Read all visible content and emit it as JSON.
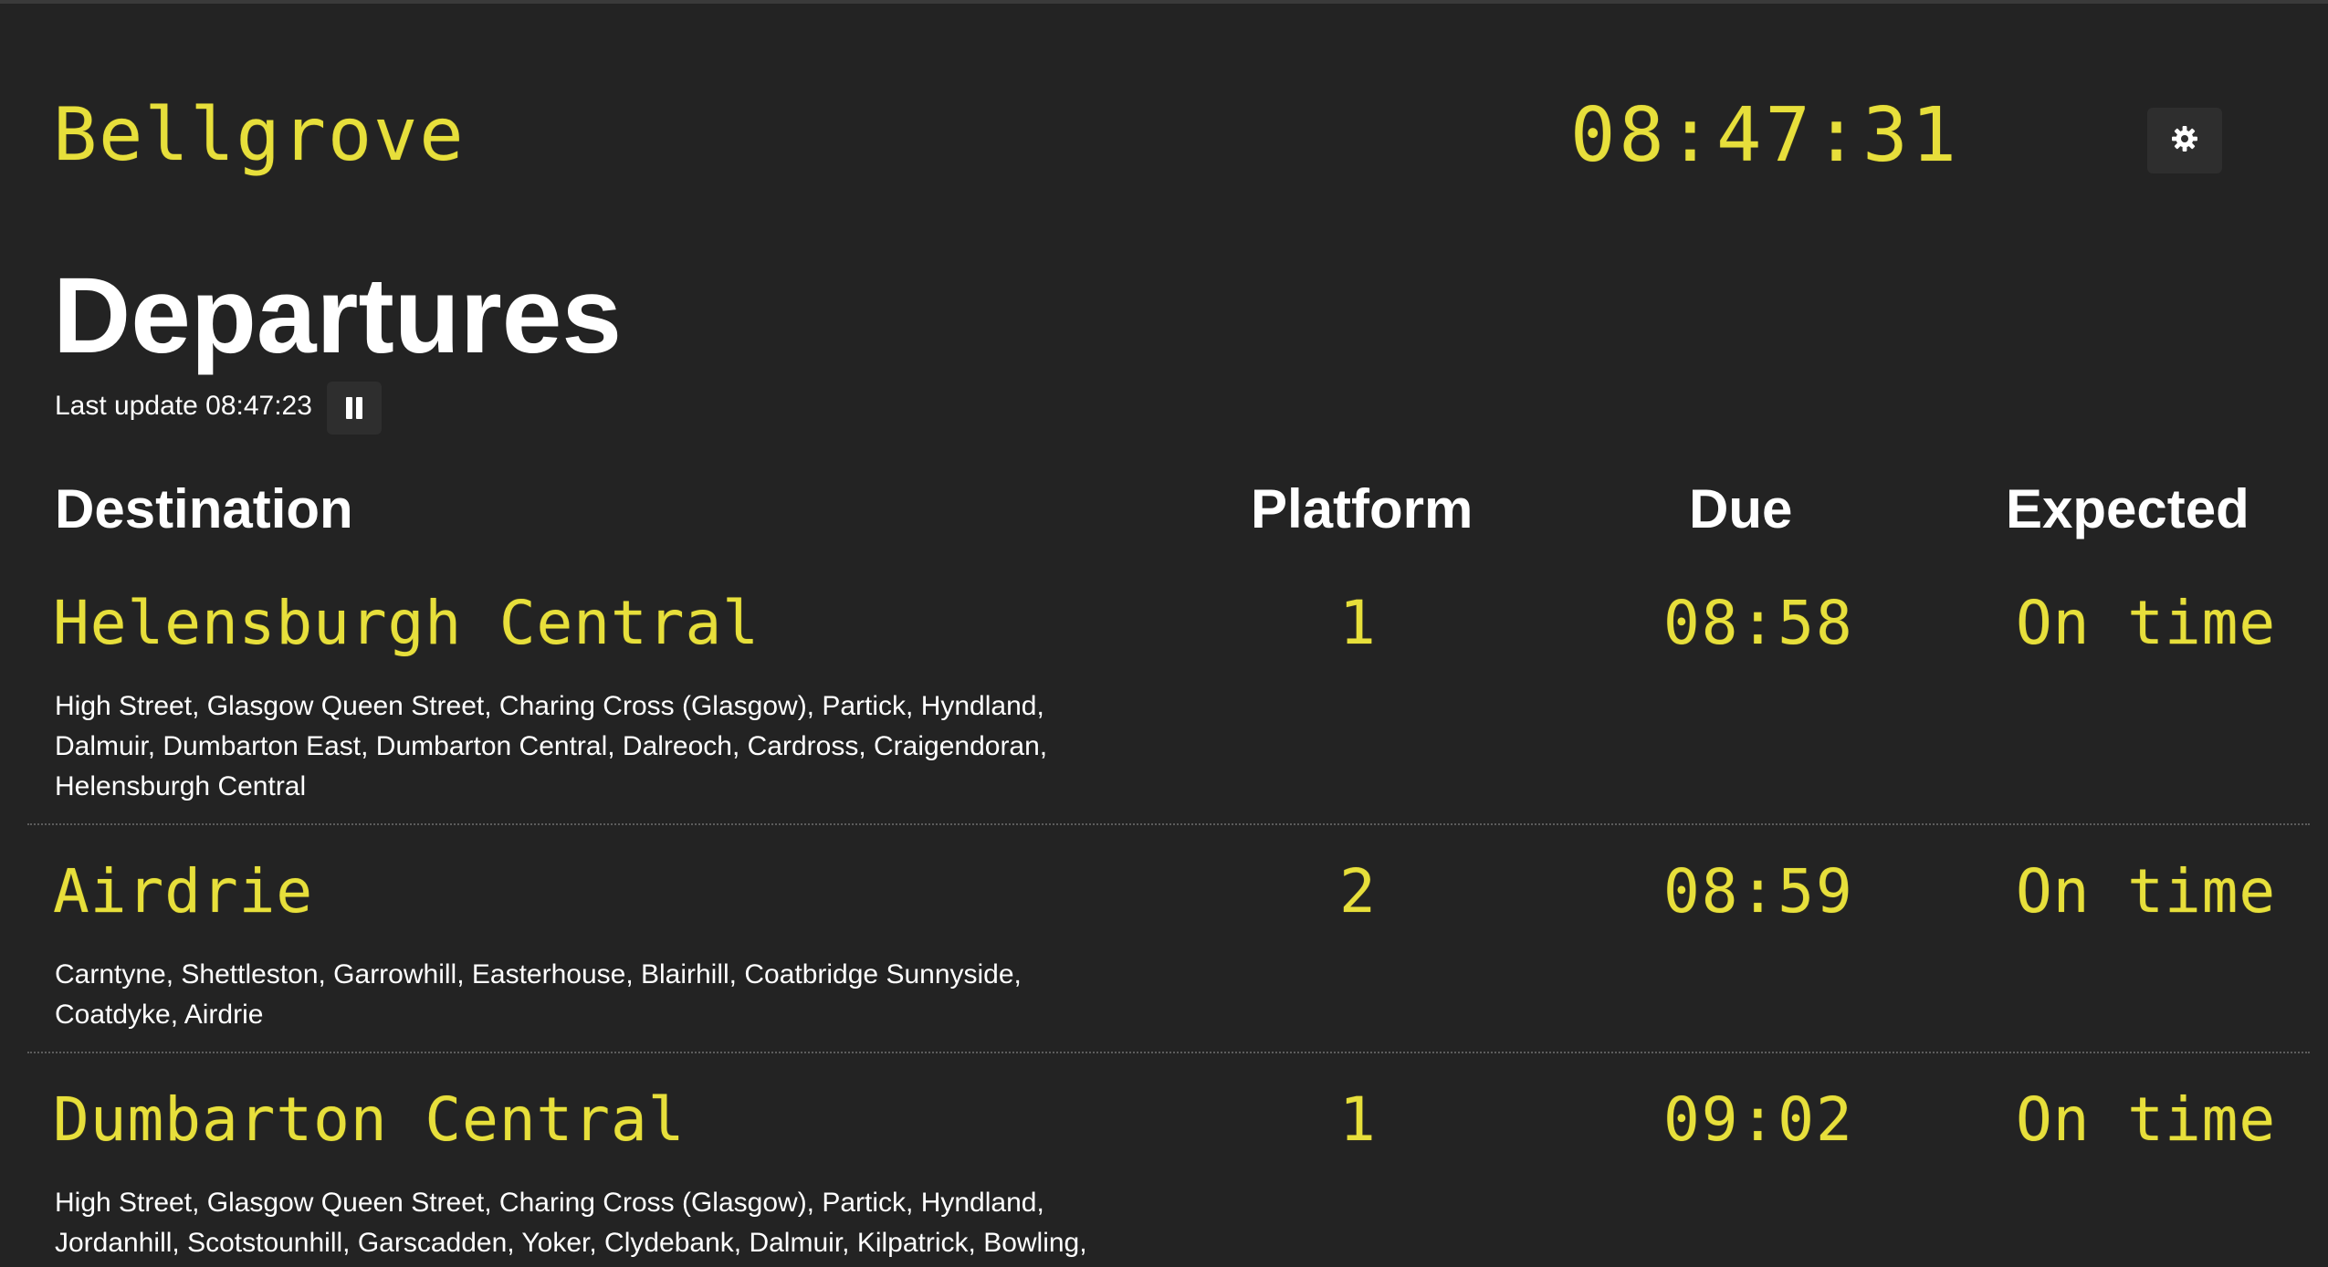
{
  "header": {
    "station": "Bellgrove",
    "clock": "08:47:31",
    "settings_icon": "gear-icon"
  },
  "title": "Departures",
  "status": {
    "last_update": "Last update 08:47:23",
    "pause_icon": "pause-icon"
  },
  "table": {
    "columns": {
      "destination": "Destination",
      "platform": "Platform",
      "due": "Due",
      "expected": "Expected"
    },
    "rows": [
      {
        "destination": "Helensburgh Central",
        "platform": "1",
        "due": "08:58",
        "expected": "On time",
        "calling_points": "High Street,  Glasgow Queen Street,  Charing Cross (Glasgow),  Partick,  Hyndland,  Dalmuir,  Dumbarton East,  Dumbarton Central,  Dalreoch,  Cardross,  Craigendoran,  Helensburgh Central"
      },
      {
        "destination": "Airdrie",
        "platform": "2",
        "due": "08:59",
        "expected": "On time",
        "calling_points": "Carntyne,  Shettleston,  Garrowhill,  Easterhouse,  Blairhill,  Coatbridge Sunnyside,  Coatdyke,  Airdrie"
      },
      {
        "destination": "Dumbarton Central",
        "platform": "1",
        "due": "09:02",
        "expected": "On time",
        "calling_points": "High Street,  Glasgow Queen Street,  Charing Cross (Glasgow),  Partick,  Hyndland,  Jordanhill,  Scotstounhill,  Garscadden,  Yoker,  Clydebank,  Dalmuir,  Kilpatrick,  Bowling,"
      }
    ]
  },
  "colors": {
    "background": "#232323",
    "led_yellow": "#e7df3b",
    "text": "#ffffff",
    "button_bg": "#2e2e2e"
  }
}
